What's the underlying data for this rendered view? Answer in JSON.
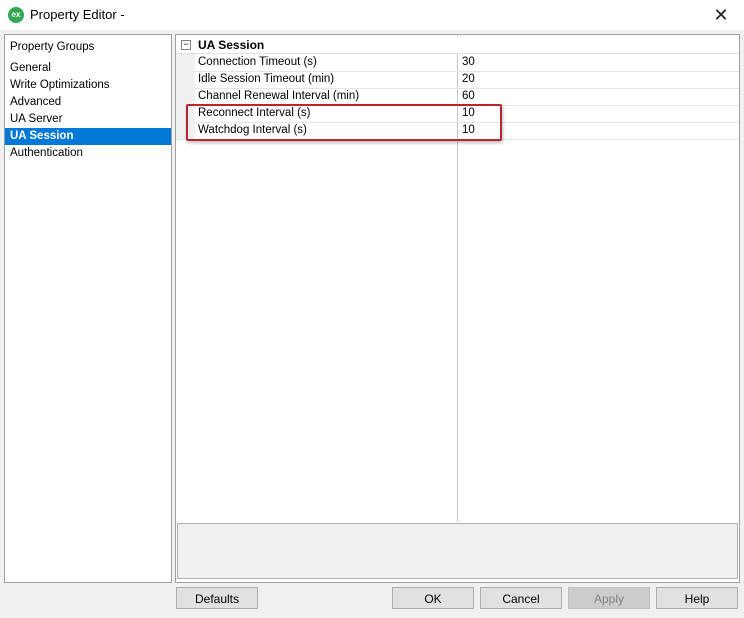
{
  "window": {
    "app_icon_text": "ex",
    "title": "Property Editor -",
    "close_glyph": "✕"
  },
  "groups": {
    "header": "Property Groups",
    "items": [
      {
        "label": "General",
        "selected": false
      },
      {
        "label": "Write Optimizations",
        "selected": false
      },
      {
        "label": "Advanced",
        "selected": false
      },
      {
        "label": "UA Server",
        "selected": false
      },
      {
        "label": "UA Session",
        "selected": true
      },
      {
        "label": "Authentication",
        "selected": false
      }
    ]
  },
  "grid": {
    "category": {
      "label": "UA Session",
      "toggle_glyph": "−"
    },
    "properties": [
      {
        "name": "Connection Timeout (s)",
        "value": "30"
      },
      {
        "name": "Idle Session Timeout (min)",
        "value": "20"
      },
      {
        "name": "Channel Renewal Interval (min)",
        "value": "60"
      },
      {
        "name": "Reconnect Interval (s)",
        "value": "10"
      },
      {
        "name": "Watchdog Interval (s)",
        "value": "10"
      }
    ],
    "highlight_color": "#b5272d"
  },
  "buttons": {
    "defaults": "Defaults",
    "ok": "OK",
    "cancel": "Cancel",
    "apply": "Apply",
    "help": "Help"
  },
  "colors": {
    "selection": "#0078d7",
    "app_icon": "#2fa84f"
  }
}
